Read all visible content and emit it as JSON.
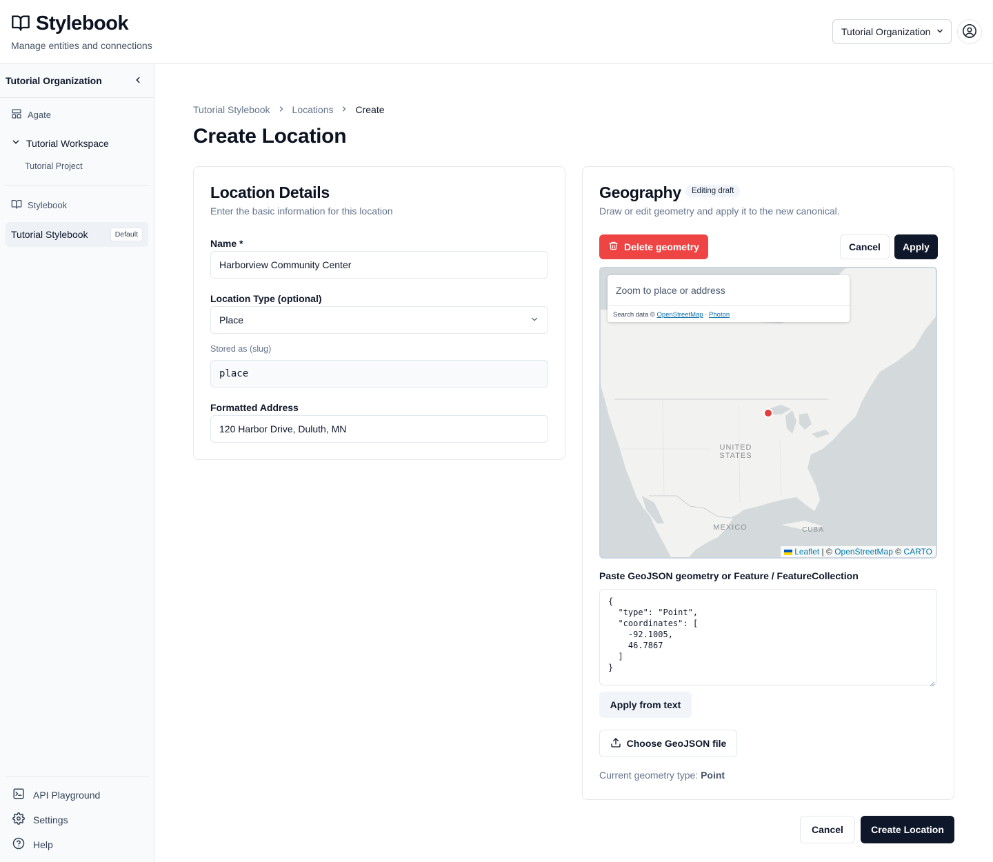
{
  "header": {
    "brand_title": "Stylebook",
    "brand_subtitle": "Manage entities and connections",
    "org_select_value": "Tutorial Organization"
  },
  "sidebar": {
    "org_label": "Tutorial Organization",
    "section_agate": "Agate",
    "workspace_label": "Tutorial Workspace",
    "project_label": "Tutorial Project",
    "section_stylebook": "Stylebook",
    "stylebook_item": "Tutorial Stylebook",
    "stylebook_badge": "Default",
    "footer": {
      "api_playground": "API Playground",
      "settings": "Settings",
      "help": "Help"
    }
  },
  "breadcrumb": {
    "items": [
      "Tutorial Stylebook",
      "Locations",
      "Create"
    ]
  },
  "page_title": "Create Location",
  "details": {
    "title": "Location Details",
    "subtitle": "Enter the basic information for this location",
    "name_label": "Name *",
    "name_value": "Harborview Community Center",
    "type_label": "Location Type (optional)",
    "type_value": "Place",
    "slug_label": "Stored as (slug)",
    "slug_value": "place",
    "address_label": "Formatted Address",
    "address_value": "120 Harbor Drive, Duluth, MN"
  },
  "geography": {
    "title": "Geography",
    "status": "Editing draft",
    "subtitle": "Draw or edit geometry and apply it to the new canonical.",
    "delete_label": "Delete geometry",
    "cancel_label": "Cancel",
    "apply_label": "Apply",
    "map": {
      "search_placeholder": "Zoom to place or address",
      "search_attr_prefix": "Search data © ",
      "search_attr_osm": "OpenStreetMap",
      "search_attr_sep": " · ",
      "search_attr_photon": "Photon",
      "label_us_1": "UNITED",
      "label_us_2": "STATES",
      "label_mexico": "MEXICO",
      "label_cuba": "CUBA",
      "attr_leaflet": "Leaflet",
      "attr_mid": " | © ",
      "attr_osm": "OpenStreetMap",
      "attr_copy": " © ",
      "attr_carto": "CARTO",
      "marker_color": "#e53e3e"
    },
    "geojson_label": "Paste GeoJSON geometry or Feature / FeatureCollection",
    "geojson_text": "{\n  \"type\": \"Point\",\n  \"coordinates\": [\n    -92.1005,\n    46.7867\n  ]\n}",
    "apply_text_label": "Apply from text",
    "choose_file_label": "Choose GeoJSON file",
    "geom_type_prefix": "Current geometry type: ",
    "geom_type_value": "Point"
  },
  "footer_actions": {
    "cancel_label": "Cancel",
    "create_label": "Create Location"
  },
  "colors": {
    "danger": "#ef4444",
    "primary_dark": "#0f172a",
    "map_land": "#f2f2f0",
    "map_water": "#d4dadc"
  }
}
